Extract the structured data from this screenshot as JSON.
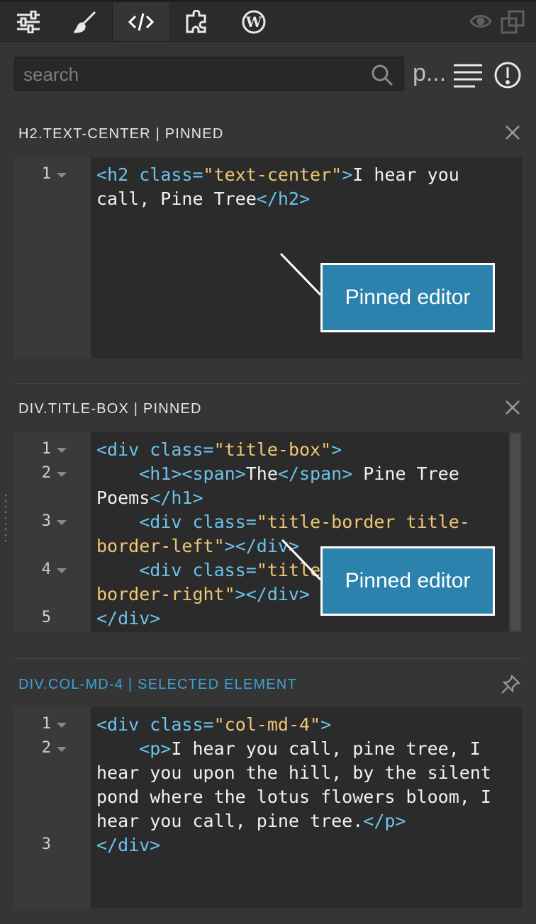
{
  "toolbar": {
    "tabs": [
      {
        "icon": "sliders-icon"
      },
      {
        "icon": "brush-icon"
      },
      {
        "icon": "code-icon",
        "active": true
      },
      {
        "icon": "puzzle-icon"
      },
      {
        "icon": "wordpress-icon"
      }
    ],
    "right_icons": [
      "eye-icon",
      "detach-window-icon"
    ]
  },
  "search": {
    "placeholder": "search",
    "value": "",
    "side_buttons": {
      "p_label": "p...",
      "list_icon": "list-icon",
      "alert_icon": "alert-circle-icon"
    }
  },
  "panels": [
    {
      "title": "H2.TEXT-CENTER | PINNED",
      "action_icon": "close-icon",
      "lines": [
        "1"
      ],
      "callout": "Pinned editor"
    },
    {
      "title": "DIV.TITLE-BOX | PINNED",
      "action_icon": "close-icon",
      "lines": [
        "1",
        "2",
        "3",
        "4",
        "5"
      ],
      "callout": "Pinned editor"
    },
    {
      "title": "DIV.COL-MD-4 | SELECTED ELEMENT",
      "action_icon": "pin-icon",
      "lines": [
        "1",
        "2",
        "3"
      ]
    }
  ],
  "code": {
    "p1": [
      [
        [
          "t",
          "<h2 "
        ],
        [
          "a",
          "class"
        ],
        [
          "t",
          "="
        ],
        [
          "s",
          "\"text-center\""
        ],
        [
          "t",
          ">"
        ],
        [
          "x",
          "I hear you"
        ]
      ],
      [
        [
          "x",
          "call, Pine Tree"
        ],
        [
          "t",
          "</h2>"
        ]
      ]
    ],
    "p2": [
      [
        [
          "t",
          "<div "
        ],
        [
          "a",
          "class"
        ],
        [
          "t",
          "="
        ],
        [
          "s",
          "\"title-box\""
        ],
        [
          "t",
          ">"
        ]
      ],
      [
        [
          "x",
          "    "
        ],
        [
          "t",
          "<h1><span>"
        ],
        [
          "x",
          "The"
        ],
        [
          "t",
          "</span>"
        ],
        [
          "x",
          " Pine Tree"
        ]
      ],
      [
        [
          "x",
          "Poems"
        ],
        [
          "t",
          "</h1>"
        ]
      ],
      [
        [
          "x",
          "    "
        ],
        [
          "t",
          "<div "
        ],
        [
          "a",
          "class"
        ],
        [
          "t",
          "="
        ],
        [
          "s",
          "\"title-border title-"
        ]
      ],
      [
        [
          "s",
          "border-left\""
        ],
        [
          "t",
          "></div>"
        ]
      ],
      [
        [
          "x",
          "    "
        ],
        [
          "t",
          "<div "
        ],
        [
          "a",
          "class"
        ],
        [
          "t",
          "="
        ],
        [
          "s",
          "\"title-"
        ]
      ],
      [
        [
          "s",
          "border-right\""
        ],
        [
          "t",
          "></div>"
        ]
      ],
      [
        [
          "t",
          "</div>"
        ]
      ]
    ],
    "p3": [
      [
        [
          "t",
          "<div "
        ],
        [
          "a",
          "class"
        ],
        [
          "t",
          "="
        ],
        [
          "s",
          "\"col-md-4\""
        ],
        [
          "t",
          ">"
        ]
      ],
      [
        [
          "x",
          "    "
        ],
        [
          "t",
          "<p>"
        ],
        [
          "x",
          "I hear you call, pine tree, I"
        ]
      ],
      [
        [
          "x",
          "hear you upon the hill, by the silent"
        ]
      ],
      [
        [
          "x",
          "pond where the lotus flowers bloom, I"
        ]
      ],
      [
        [
          "x",
          "hear you call, pine tree."
        ],
        [
          "t",
          "</p>"
        ]
      ],
      [
        [
          "t",
          "</div>"
        ]
      ]
    ]
  }
}
